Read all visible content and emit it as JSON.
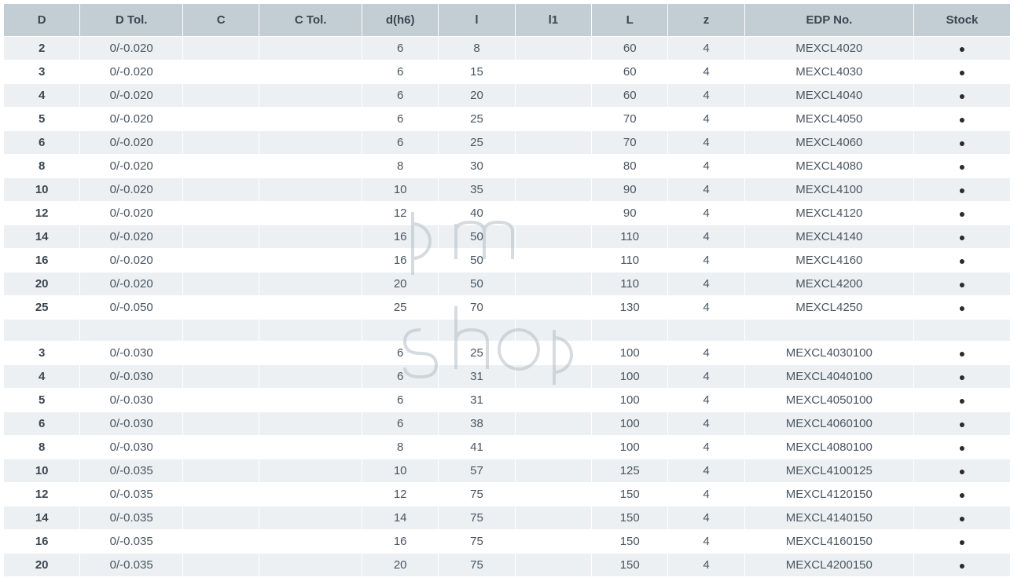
{
  "headers": {
    "d": "D",
    "d_tol": "D Tol.",
    "c": "C",
    "c_tol": "C Tol.",
    "d_h6": "d(h6)",
    "l": "l",
    "l1": "l1",
    "big_l": "L",
    "z": "z",
    "edp": "EDP No.",
    "stock": "Stock"
  },
  "rows": [
    {
      "d": "2",
      "d_tol": "0/-0.020",
      "c": "",
      "c_tol": "",
      "d_h6": "6",
      "l": "8",
      "l1": "",
      "big_l": "60",
      "z": "4",
      "edp": "MEXCL4020",
      "stock": "●"
    },
    {
      "d": "3",
      "d_tol": "0/-0.020",
      "c": "",
      "c_tol": "",
      "d_h6": "6",
      "l": "15",
      "l1": "",
      "big_l": "60",
      "z": "4",
      "edp": "MEXCL4030",
      "stock": "●"
    },
    {
      "d": "4",
      "d_tol": "0/-0.020",
      "c": "",
      "c_tol": "",
      "d_h6": "6",
      "l": "20",
      "l1": "",
      "big_l": "60",
      "z": "4",
      "edp": "MEXCL4040",
      "stock": "●"
    },
    {
      "d": "5",
      "d_tol": "0/-0.020",
      "c": "",
      "c_tol": "",
      "d_h6": "6",
      "l": "25",
      "l1": "",
      "big_l": "70",
      "z": "4",
      "edp": "MEXCL4050",
      "stock": "●"
    },
    {
      "d": "6",
      "d_tol": "0/-0.020",
      "c": "",
      "c_tol": "",
      "d_h6": "6",
      "l": "25",
      "l1": "",
      "big_l": "70",
      "z": "4",
      "edp": "MEXCL4060",
      "stock": "●"
    },
    {
      "d": "8",
      "d_tol": "0/-0.020",
      "c": "",
      "c_tol": "",
      "d_h6": "8",
      "l": "30",
      "l1": "",
      "big_l": "80",
      "z": "4",
      "edp": "MEXCL4080",
      "stock": "●"
    },
    {
      "d": "10",
      "d_tol": "0/-0.020",
      "c": "",
      "c_tol": "",
      "d_h6": "10",
      "l": "35",
      "l1": "",
      "big_l": "90",
      "z": "4",
      "edp": "MEXCL4100",
      "stock": "●"
    },
    {
      "d": "12",
      "d_tol": "0/-0.020",
      "c": "",
      "c_tol": "",
      "d_h6": "12",
      "l": "40",
      "l1": "",
      "big_l": "90",
      "z": "4",
      "edp": "MEXCL4120",
      "stock": "●"
    },
    {
      "d": "14",
      "d_tol": "0/-0.020",
      "c": "",
      "c_tol": "",
      "d_h6": "16",
      "l": "50",
      "l1": "",
      "big_l": "110",
      "z": "4",
      "edp": "MEXCL4140",
      "stock": "●"
    },
    {
      "d": "16",
      "d_tol": "0/-0.020",
      "c": "",
      "c_tol": "",
      "d_h6": "16",
      "l": "50",
      "l1": "",
      "big_l": "110",
      "z": "4",
      "edp": "MEXCL4160",
      "stock": "●"
    },
    {
      "d": "20",
      "d_tol": "0/-0.020",
      "c": "",
      "c_tol": "",
      "d_h6": "20",
      "l": "50",
      "l1": "",
      "big_l": "110",
      "z": "4",
      "edp": "MEXCL4200",
      "stock": "●"
    },
    {
      "d": "25",
      "d_tol": "0/-0.050",
      "c": "",
      "c_tol": "",
      "d_h6": "25",
      "l": "70",
      "l1": "",
      "big_l": "130",
      "z": "4",
      "edp": "MEXCL4250",
      "stock": "●"
    },
    {
      "d": "",
      "d_tol": "",
      "c": "",
      "c_tol": "",
      "d_h6": "",
      "l": "",
      "l1": "",
      "big_l": "",
      "z": "",
      "edp": "",
      "stock": ""
    },
    {
      "d": "3",
      "d_tol": "0/-0.030",
      "c": "",
      "c_tol": "",
      "d_h6": "6",
      "l": "25",
      "l1": "",
      "big_l": "100",
      "z": "4",
      "edp": "MEXCL4030100",
      "stock": "●"
    },
    {
      "d": "4",
      "d_tol": "0/-0.030",
      "c": "",
      "c_tol": "",
      "d_h6": "6",
      "l": "31",
      "l1": "",
      "big_l": "100",
      "z": "4",
      "edp": "MEXCL4040100",
      "stock": "●"
    },
    {
      "d": "5",
      "d_tol": "0/-0.030",
      "c": "",
      "c_tol": "",
      "d_h6": "6",
      "l": "31",
      "l1": "",
      "big_l": "100",
      "z": "4",
      "edp": "MEXCL4050100",
      "stock": "●"
    },
    {
      "d": "6",
      "d_tol": "0/-0.030",
      "c": "",
      "c_tol": "",
      "d_h6": "6",
      "l": "38",
      "l1": "",
      "big_l": "100",
      "z": "4",
      "edp": "MEXCL4060100",
      "stock": "●"
    },
    {
      "d": "8",
      "d_tol": "0/-0.030",
      "c": "",
      "c_tol": "",
      "d_h6": "8",
      "l": "41",
      "l1": "",
      "big_l": "100",
      "z": "4",
      "edp": "MEXCL4080100",
      "stock": "●"
    },
    {
      "d": "10",
      "d_tol": "0/-0.035",
      "c": "",
      "c_tol": "",
      "d_h6": "10",
      "l": "57",
      "l1": "",
      "big_l": "125",
      "z": "4",
      "edp": "MEXCL4100125",
      "stock": "●"
    },
    {
      "d": "12",
      "d_tol": "0/-0.035",
      "c": "",
      "c_tol": "",
      "d_h6": "12",
      "l": "75",
      "l1": "",
      "big_l": "150",
      "z": "4",
      "edp": "MEXCL4120150",
      "stock": "●"
    },
    {
      "d": "14",
      "d_tol": "0/-0.035",
      "c": "",
      "c_tol": "",
      "d_h6": "14",
      "l": "75",
      "l1": "",
      "big_l": "150",
      "z": "4",
      "edp": "MEXCL4140150",
      "stock": "●"
    },
    {
      "d": "16",
      "d_tol": "0/-0.035",
      "c": "",
      "c_tol": "",
      "d_h6": "16",
      "l": "75",
      "l1": "",
      "big_l": "150",
      "z": "4",
      "edp": "MEXCL4160150",
      "stock": "●"
    },
    {
      "d": "20",
      "d_tol": "0/-0.035",
      "c": "",
      "c_tol": "",
      "d_h6": "20",
      "l": "75",
      "l1": "",
      "big_l": "150",
      "z": "4",
      "edp": "MEXCL4200150",
      "stock": "●"
    }
  ],
  "watermark": "pm shop"
}
